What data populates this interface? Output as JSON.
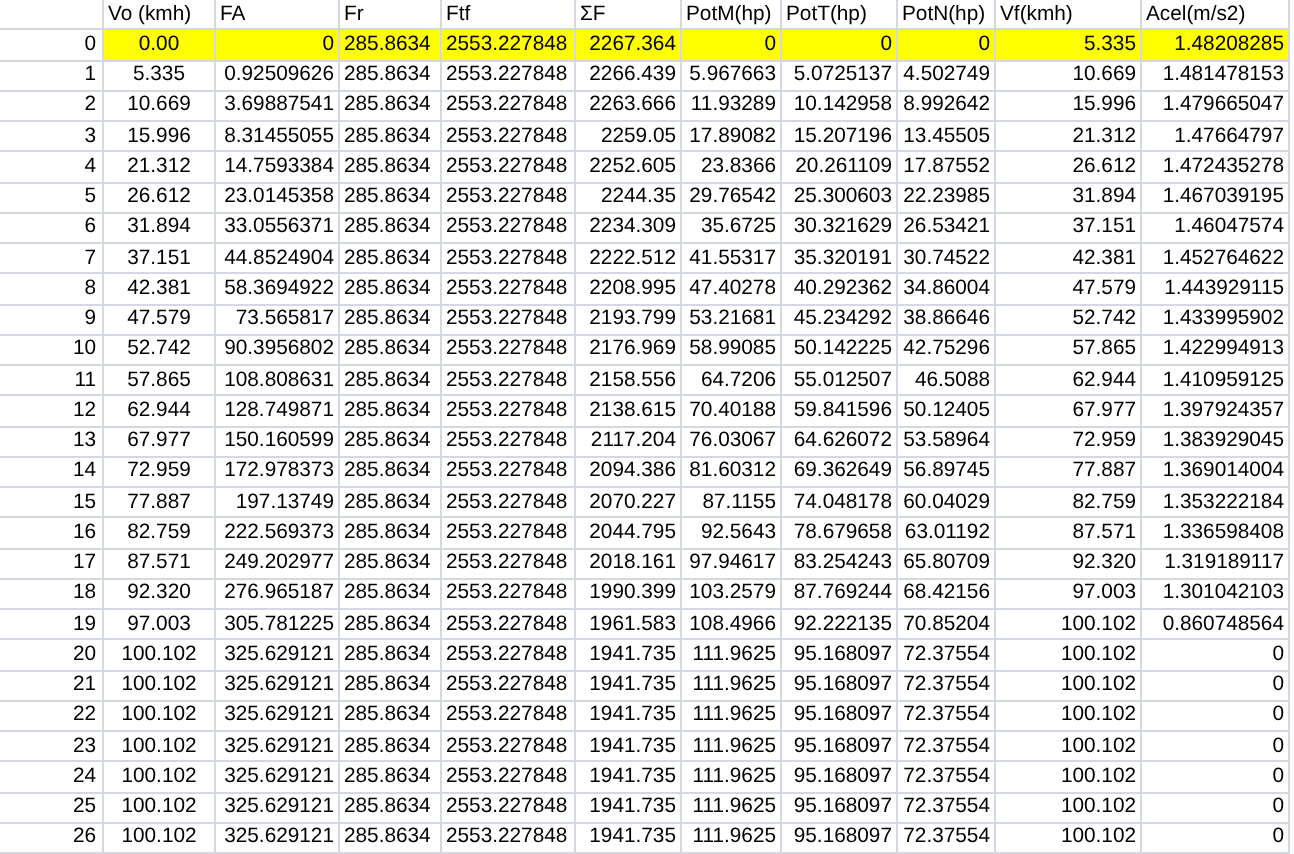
{
  "table": {
    "columns": [
      "Vo (kmh)",
      "FA",
      "Fr",
      "Ftf",
      "ΣF",
      "PotM(hp)",
      "PotT(hp)",
      "PotN(hp)",
      "Vf(kmh)",
      "Acel(m/s2)"
    ],
    "rows": [
      {
        "index": "0",
        "highlighted": true,
        "cells": [
          "0.00",
          "0",
          "285.8634",
          "2553.227848",
          "2267.364",
          "0",
          "0",
          "0",
          "5.335",
          "1.48208285"
        ]
      },
      {
        "index": "1",
        "highlighted": false,
        "cells": [
          "5.335",
          "0.92509626",
          "285.8634",
          "2553.227848",
          "2266.439",
          "5.967663",
          "5.0725137",
          "4.502749",
          "10.669",
          "1.481478153"
        ]
      },
      {
        "index": "2",
        "highlighted": false,
        "cells": [
          "10.669",
          "3.69887541",
          "285.8634",
          "2553.227848",
          "2263.666",
          "11.93289",
          "10.142958",
          "8.992642",
          "15.996",
          "1.479665047"
        ]
      },
      {
        "index": "3",
        "highlighted": false,
        "cells": [
          "15.996",
          "8.31455055",
          "285.8634",
          "2553.227848",
          "2259.05",
          "17.89082",
          "15.207196",
          "13.45505",
          "21.312",
          "1.47664797"
        ]
      },
      {
        "index": "4",
        "highlighted": false,
        "cells": [
          "21.312",
          "14.7593384",
          "285.8634",
          "2553.227848",
          "2252.605",
          "23.8366",
          "20.261109",
          "17.87552",
          "26.612",
          "1.472435278"
        ]
      },
      {
        "index": "5",
        "highlighted": false,
        "cells": [
          "26.612",
          "23.0145358",
          "285.8634",
          "2553.227848",
          "2244.35",
          "29.76542",
          "25.300603",
          "22.23985",
          "31.894",
          "1.467039195"
        ]
      },
      {
        "index": "6",
        "highlighted": false,
        "cells": [
          "31.894",
          "33.0556371",
          "285.8634",
          "2553.227848",
          "2234.309",
          "35.6725",
          "30.321629",
          "26.53421",
          "37.151",
          "1.46047574"
        ]
      },
      {
        "index": "7",
        "highlighted": false,
        "cells": [
          "37.151",
          "44.8524904",
          "285.8634",
          "2553.227848",
          "2222.512",
          "41.55317",
          "35.320191",
          "30.74522",
          "42.381",
          "1.452764622"
        ]
      },
      {
        "index": "8",
        "highlighted": false,
        "cells": [
          "42.381",
          "58.3694922",
          "285.8634",
          "2553.227848",
          "2208.995",
          "47.40278",
          "40.292362",
          "34.86004",
          "47.579",
          "1.443929115"
        ]
      },
      {
        "index": "9",
        "highlighted": false,
        "cells": [
          "47.579",
          "73.565817",
          "285.8634",
          "2553.227848",
          "2193.799",
          "53.21681",
          "45.234292",
          "38.86646",
          "52.742",
          "1.433995902"
        ]
      },
      {
        "index": "10",
        "highlighted": false,
        "cells": [
          "52.742",
          "90.3956802",
          "285.8634",
          "2553.227848",
          "2176.969",
          "58.99085",
          "50.142225",
          "42.75296",
          "57.865",
          "1.422994913"
        ]
      },
      {
        "index": "11",
        "highlighted": false,
        "cells": [
          "57.865",
          "108.808631",
          "285.8634",
          "2553.227848",
          "2158.556",
          "64.7206",
          "55.012507",
          "46.5088",
          "62.944",
          "1.410959125"
        ]
      },
      {
        "index": "12",
        "highlighted": false,
        "cells": [
          "62.944",
          "128.749871",
          "285.8634",
          "2553.227848",
          "2138.615",
          "70.40188",
          "59.841596",
          "50.12405",
          "67.977",
          "1.397924357"
        ]
      },
      {
        "index": "13",
        "highlighted": false,
        "cells": [
          "67.977",
          "150.160599",
          "285.8634",
          "2553.227848",
          "2117.204",
          "76.03067",
          "64.626072",
          "53.58964",
          "72.959",
          "1.383929045"
        ]
      },
      {
        "index": "14",
        "highlighted": false,
        "cells": [
          "72.959",
          "172.978373",
          "285.8634",
          "2553.227848",
          "2094.386",
          "81.60312",
          "69.362649",
          "56.89745",
          "77.887",
          "1.369014004"
        ]
      },
      {
        "index": "15",
        "highlighted": false,
        "cells": [
          "77.887",
          "197.13749",
          "285.8634",
          "2553.227848",
          "2070.227",
          "87.1155",
          "74.048178",
          "60.04029",
          "82.759",
          "1.353222184"
        ]
      },
      {
        "index": "16",
        "highlighted": false,
        "cells": [
          "82.759",
          "222.569373",
          "285.8634",
          "2553.227848",
          "2044.795",
          "92.5643",
          "78.679658",
          "63.01192",
          "87.571",
          "1.336598408"
        ]
      },
      {
        "index": "17",
        "highlighted": false,
        "cells": [
          "87.571",
          "249.202977",
          "285.8634",
          "2553.227848",
          "2018.161",
          "97.94617",
          "83.254243",
          "65.80709",
          "92.320",
          "1.319189117"
        ]
      },
      {
        "index": "18",
        "highlighted": false,
        "cells": [
          "92.320",
          "276.965187",
          "285.8634",
          "2553.227848",
          "1990.399",
          "103.2579",
          "87.769244",
          "68.42156",
          "97.003",
          "1.301042103"
        ]
      },
      {
        "index": "19",
        "highlighted": false,
        "cells": [
          "97.003",
          "305.781225",
          "285.8634",
          "2553.227848",
          "1961.583",
          "108.4966",
          "92.222135",
          "70.85204",
          "100.102",
          "0.860748564"
        ]
      },
      {
        "index": "20",
        "highlighted": false,
        "cells": [
          "100.102",
          "325.629121",
          "285.8634",
          "2553.227848",
          "1941.735",
          "111.9625",
          "95.168097",
          "72.37554",
          "100.102",
          "0"
        ]
      },
      {
        "index": "21",
        "highlighted": false,
        "cells": [
          "100.102",
          "325.629121",
          "285.8634",
          "2553.227848",
          "1941.735",
          "111.9625",
          "95.168097",
          "72.37554",
          "100.102",
          "0"
        ]
      },
      {
        "index": "22",
        "highlighted": false,
        "cells": [
          "100.102",
          "325.629121",
          "285.8634",
          "2553.227848",
          "1941.735",
          "111.9625",
          "95.168097",
          "72.37554",
          "100.102",
          "0"
        ]
      },
      {
        "index": "23",
        "highlighted": false,
        "cells": [
          "100.102",
          "325.629121",
          "285.8634",
          "2553.227848",
          "1941.735",
          "111.9625",
          "95.168097",
          "72.37554",
          "100.102",
          "0"
        ]
      },
      {
        "index": "24",
        "highlighted": false,
        "cells": [
          "100.102",
          "325.629121",
          "285.8634",
          "2553.227848",
          "1941.735",
          "111.9625",
          "95.168097",
          "72.37554",
          "100.102",
          "0"
        ]
      },
      {
        "index": "25",
        "highlighted": false,
        "cells": [
          "100.102",
          "325.629121",
          "285.8634",
          "2553.227848",
          "1941.735",
          "111.9625",
          "95.168097",
          "72.37554",
          "100.102",
          "0"
        ]
      },
      {
        "index": "26",
        "highlighted": false,
        "cells": [
          "100.102",
          "325.629121",
          "285.8634",
          "2553.227848",
          "1941.735",
          "111.9625",
          "95.168097",
          "72.37554",
          "100.102",
          "0"
        ]
      }
    ]
  }
}
